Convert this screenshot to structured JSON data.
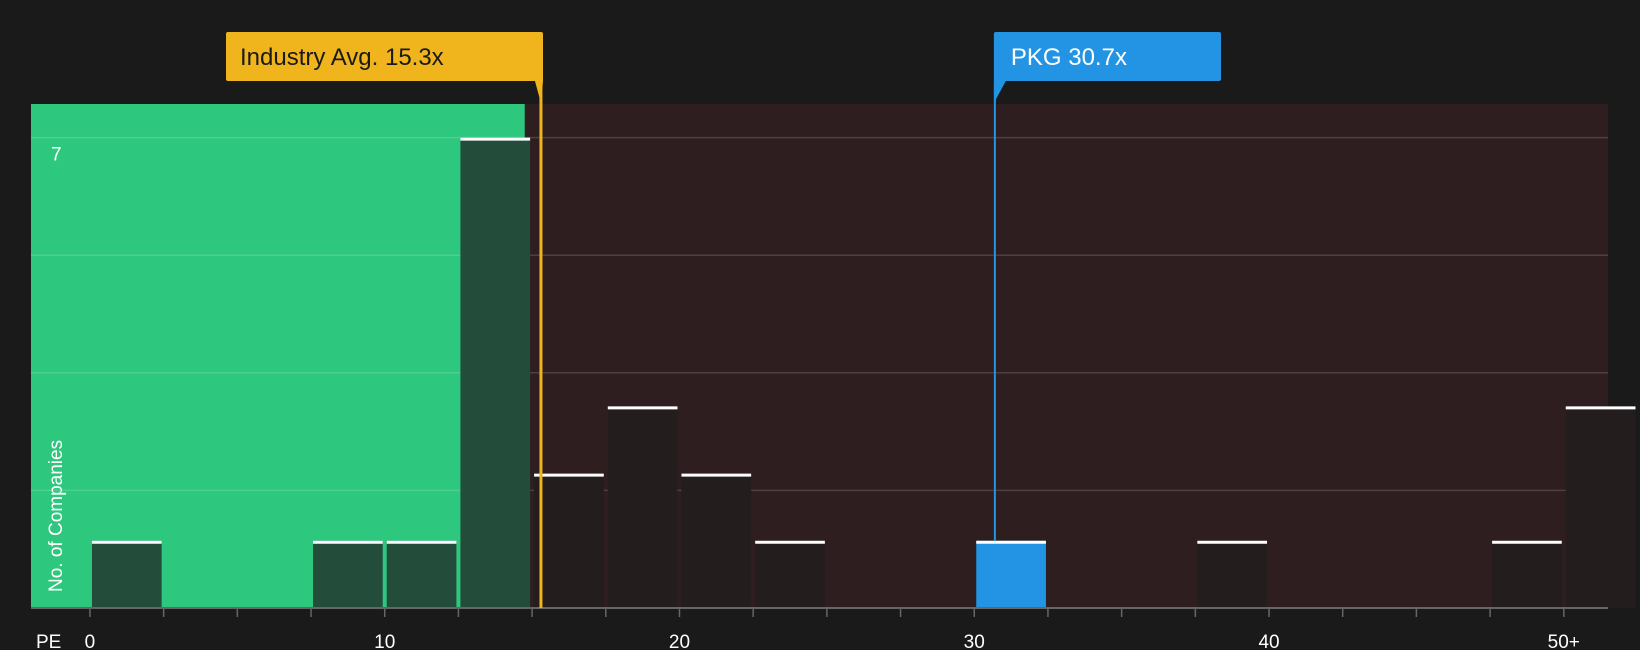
{
  "chart_data": {
    "type": "bar",
    "xlabel": "PE",
    "ylabel": "No. of Companies",
    "xlim": [
      -2,
      51.5
    ],
    "ylim": [
      0,
      7.5
    ],
    "x_ticks": [
      {
        "value": 0,
        "label": "0"
      },
      {
        "value": 10,
        "label": "10"
      },
      {
        "value": 20,
        "label": "20"
      },
      {
        "value": 30,
        "label": "30"
      },
      {
        "value": 40,
        "label": "40"
      },
      {
        "value": 50,
        "label": "50+"
      }
    ],
    "y_gridlines": [
      1.75,
      3.5,
      5.25,
      7
    ],
    "y_max_label": "7",
    "bin_width": 2.5,
    "bins": [
      {
        "start": 0,
        "count": 1
      },
      {
        "start": 7.5,
        "count": 1
      },
      {
        "start": 10,
        "count": 1
      },
      {
        "start": 12.5,
        "count": 7
      },
      {
        "start": 15,
        "count": 2
      },
      {
        "start": 17.5,
        "count": 3
      },
      {
        "start": 20,
        "count": 2
      },
      {
        "start": 22.5,
        "count": 1
      },
      {
        "start": 30,
        "count": 1,
        "highlight": true
      },
      {
        "start": 37.5,
        "count": 1
      },
      {
        "start": 47.5,
        "count": 1
      },
      {
        "start": 50,
        "count": 3
      }
    ],
    "industry_avg": {
      "value": 15.3,
      "label": "Industry Avg. 15.3x",
      "color": "#f0b51d"
    },
    "company": {
      "value": 30.7,
      "label": "PKG 30.7x",
      "color": "#2394e3"
    },
    "colors": {
      "background": "#1a1a1a",
      "good_zone": "#2ec77e",
      "bad_zone": "#2f1e1f",
      "bar_on_good": "#234d3a",
      "bar_on_bad": "#231d1d",
      "bar_top": "#ffffff",
      "grid": "#ffffff",
      "axis": "#666666"
    }
  }
}
